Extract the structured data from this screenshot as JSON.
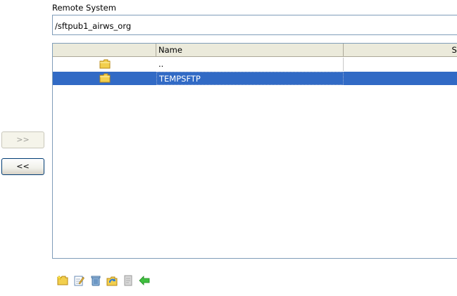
{
  "remote": {
    "label": "Remote System",
    "path": "/sftpub1_airws_org"
  },
  "table": {
    "columns": [
      "",
      "Name",
      "Si"
    ],
    "rows": [
      {
        "icon": "folder-icon",
        "name": "..",
        "selected": false
      },
      {
        "icon": "folder-icon",
        "name": "TEMPSFTP",
        "selected": true
      }
    ]
  },
  "transfer": {
    "upload_label": ">>",
    "download_label": "<<"
  },
  "toolbar": {
    "icons": [
      "new-folder-icon",
      "rename-icon",
      "delete-icon",
      "refresh-icon",
      "properties-icon",
      "back-icon"
    ]
  },
  "colors": {
    "selection": "#316ac5",
    "header": "#ebeadb",
    "border": "#7f9db9"
  }
}
